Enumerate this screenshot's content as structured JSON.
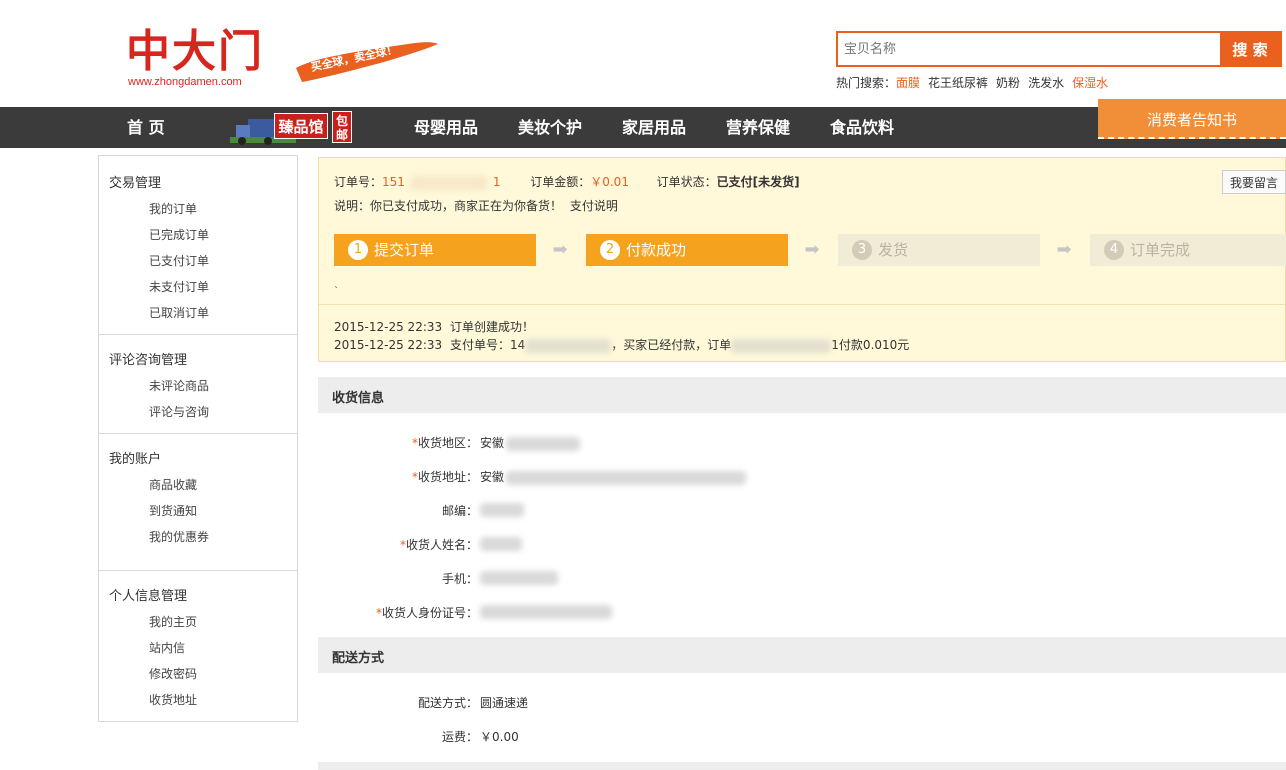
{
  "header": {
    "logo_text": "中大门",
    "logo_url": "www.zhongdamen.com",
    "slogan": "买全球，卖全球！",
    "search_placeholder": "宝贝名称",
    "search_button": "搜 索",
    "hot_label": "热门搜索：",
    "hot_items": [
      "面膜",
      "花王纸尿裤",
      "奶粉",
      "洗发水",
      "保湿水"
    ]
  },
  "nav": {
    "home": "首 页",
    "promo_main": "臻品馆",
    "promo_side": "包邮",
    "items": [
      "母婴用品",
      "美妆个护",
      "家居用品",
      "营养保健",
      "食品饮料"
    ],
    "notice": "消费者告知书"
  },
  "sidebar": {
    "groups": [
      {
        "title": "交易管理",
        "links": [
          "我的订单",
          "已完成订单",
          "已支付订单",
          "未支付订单",
          "已取消订单"
        ]
      },
      {
        "title": "评论咨询管理",
        "links": [
          "未评论商品",
          "评论与咨询"
        ]
      },
      {
        "title": "我的账户",
        "links": [
          "商品收藏",
          "到货通知",
          "我的优惠券"
        ]
      },
      {
        "title": "个人信息管理",
        "links": [
          "我的主页",
          "站内信",
          "修改密码",
          "收货地址"
        ]
      }
    ]
  },
  "order": {
    "number_label": "订单号：",
    "number_prefix": "151",
    "number_suffix": "1",
    "amount_label": "订单金额：",
    "amount": "￥0.01",
    "status_label": "订单状态：",
    "status": "已支付[未发货]",
    "note": "说明：你已支付成功，商家正在为你备货！",
    "note_link": "支付说明",
    "message_button": "我要留言",
    "steps": [
      {
        "num": "1",
        "label": "提交订单",
        "active": true
      },
      {
        "num": "2",
        "label": "付款成功",
        "active": true
      },
      {
        "num": "3",
        "label": "发货",
        "active": false
      },
      {
        "num": "4",
        "label": "订单完成",
        "active": false
      }
    ],
    "tick": "`",
    "logs": [
      {
        "time": "2015-12-25 22:33",
        "text_a": "订单创建成功！",
        "text_b": "",
        "text_c": ""
      },
      {
        "time": "2015-12-25 22:33",
        "text_a": "支付单号：14",
        "text_b": "，买家已经付款，订单",
        "text_c": "1付款0.010元"
      }
    ]
  },
  "shipping_info": {
    "title": "收货信息",
    "fields": [
      {
        "label": "收货地区：",
        "required": true,
        "value": "安徽"
      },
      {
        "label": "收货地址：",
        "required": true,
        "value": "安徽"
      },
      {
        "label": "邮编：",
        "required": false,
        "value": ""
      },
      {
        "label": "收货人姓名：",
        "required": true,
        "value": ""
      },
      {
        "label": "手机：",
        "required": false,
        "value": ""
      },
      {
        "label": "收货人身份证号：",
        "required": true,
        "value": ""
      }
    ]
  },
  "delivery": {
    "title": "配送方式",
    "method_label": "配送方式：",
    "method_value": "圆通速递",
    "fee_label": "运费：",
    "fee_value": "￥0.00"
  },
  "colors": {
    "accent": "#e9601f",
    "step_active": "#f5a21f",
    "nav_bg": "#3b3b3b",
    "order_bg": "#fff8d9"
  }
}
